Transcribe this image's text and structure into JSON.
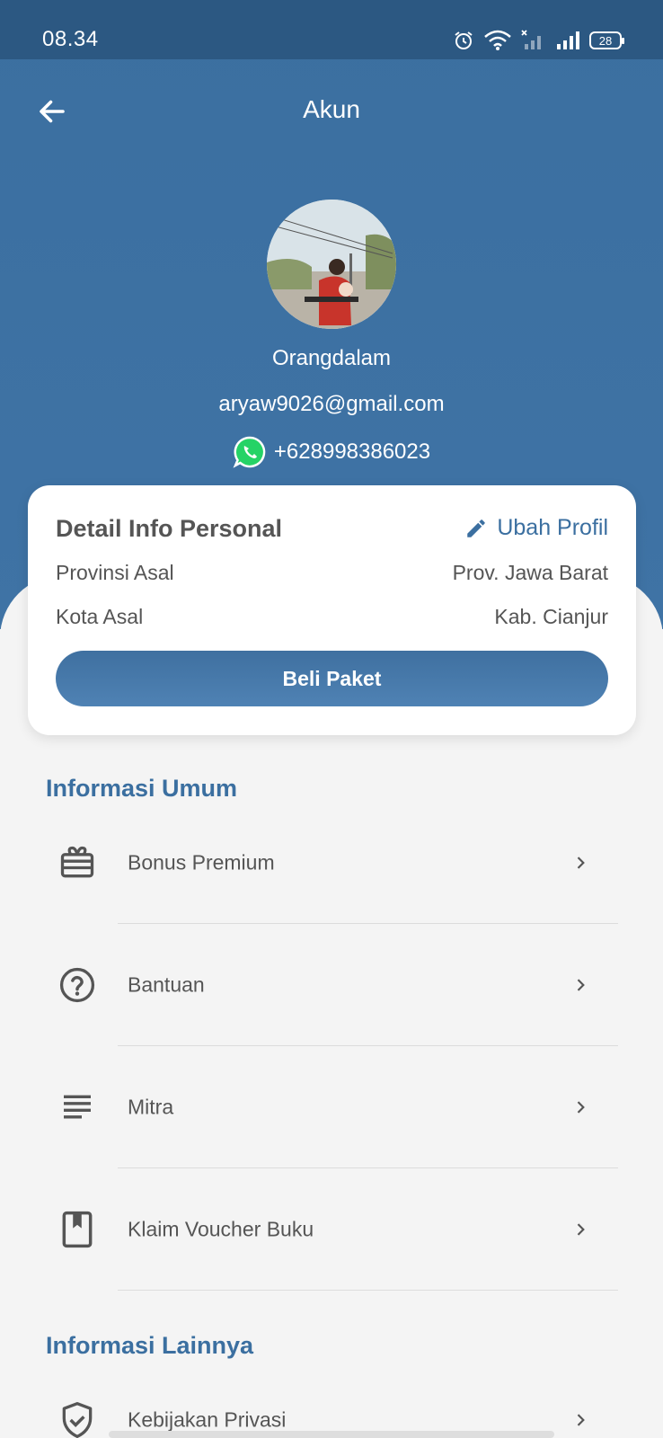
{
  "status_bar": {
    "time": "08.34",
    "battery": "28"
  },
  "appbar": {
    "title": "Akun"
  },
  "profile": {
    "name": "Orangdalam",
    "email": "aryaw9026@gmail.com",
    "phone": "+628998386023"
  },
  "personal_card": {
    "title": "Detail Info Personal",
    "edit_label": "Ubah Profil",
    "rows": [
      {
        "label": "Provinsi Asal",
        "value": "Prov. Jawa Barat"
      },
      {
        "label": "Kota Asal",
        "value": "Kab. Cianjur"
      }
    ],
    "buy_label": "Beli Paket"
  },
  "sections": {
    "general_title": "Informasi Umum",
    "general_items": [
      {
        "label": "Bonus Premium",
        "icon": "gift-card-icon"
      },
      {
        "label": "Bantuan",
        "icon": "help-circle-icon"
      },
      {
        "label": "Mitra",
        "icon": "lines-icon"
      },
      {
        "label": "Klaim Voucher Buku",
        "icon": "book-icon"
      }
    ],
    "other_title": "Informasi Lainnya",
    "other_items": [
      {
        "label": "Kebijakan Privasi",
        "icon": "shield-check-icon"
      }
    ]
  },
  "colors": {
    "primary": "#3b6fa0",
    "status_bar": "#2c5882",
    "background": "#f4f4f4"
  }
}
